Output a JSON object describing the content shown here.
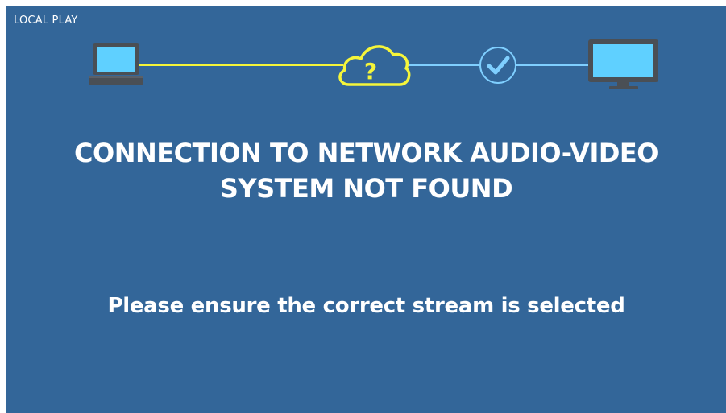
{
  "mode": {
    "label": "LOCAL PLAY"
  },
  "connection_diagram": {
    "source_device_icon": "laptop-icon",
    "network_icon": "cloud-question-icon",
    "status_icon": "checkmark-circle-icon",
    "target_device_icon": "monitor-icon",
    "cloud_glyph": "?",
    "colors": {
      "background": "#336699",
      "warning_line": "#f5f53a",
      "ok_line": "#7fcfff",
      "device_screen": "#5fd0ff",
      "device_body": "#4a4f55"
    }
  },
  "message": {
    "headline_line1": "CONNECTION TO NETWORK AUDIO-VIDEO",
    "headline_line2": "SYSTEM NOT FOUND",
    "hint": "Please ensure the correct stream is selected"
  }
}
